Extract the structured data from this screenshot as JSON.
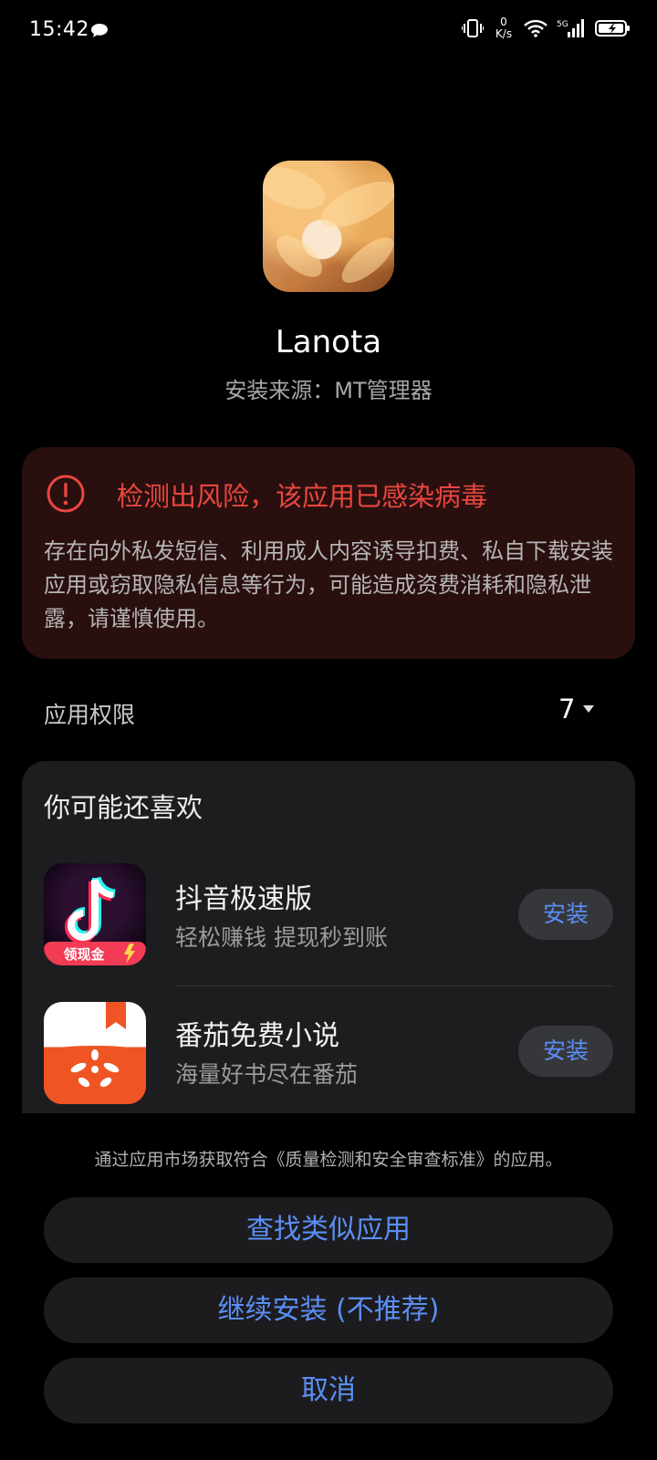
{
  "status_bar": {
    "time": "15:42",
    "net_speed_value": "0",
    "net_speed_unit": "K/s",
    "network_type": "5G",
    "icons": [
      "chat-bubble-icon",
      "vibrate-icon",
      "wifi-icon",
      "signal-icon",
      "battery-charging-icon"
    ]
  },
  "app": {
    "name": "Lanota",
    "install_source": "安装来源：MT管理器"
  },
  "warning": {
    "title": "检测出风险，该应用已感染病毒",
    "body": "存在向外私发短信、利用成人内容诱导扣费、私自下载安装应用或窃取隐私信息等行为，可能造成资费消耗和隐私泄露，请谨慎使用。",
    "color": "#e8473f"
  },
  "permissions": {
    "label": "应用权限",
    "count": "7"
  },
  "recommendations": {
    "title": "你可能还喜欢",
    "apps": [
      {
        "name": "抖音极速版",
        "desc": "轻松赚钱 提现秒到账",
        "install_label": "安装",
        "badge": "领现金"
      },
      {
        "name": "番茄免费小说",
        "desc": "海量好书尽在番茄",
        "install_label": "安装"
      }
    ]
  },
  "footer": {
    "note": "通过应用市场获取符合《质量检测和安全审查标准》的应用。",
    "find_similar": "查找类似应用",
    "continue_install": "继续安装 (不推荐)",
    "cancel": "取消"
  },
  "colors": {
    "accent": "#5b8ff7",
    "card_bg": "#1d1d1f",
    "warn_bg": "#2a0f0f"
  }
}
